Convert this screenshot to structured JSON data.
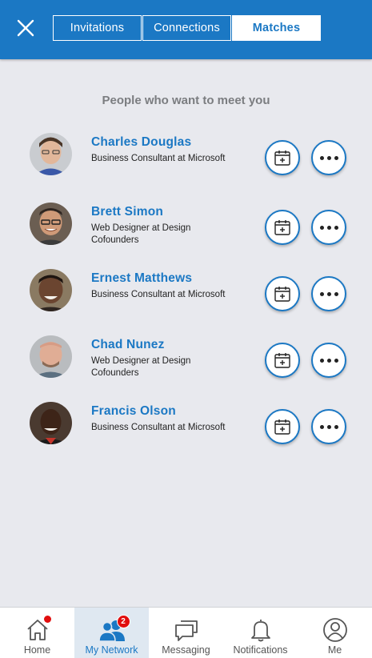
{
  "header": {
    "close_icon": "close-icon",
    "tabs": [
      {
        "label": "Invitations",
        "active": false
      },
      {
        "label": "Connections",
        "active": false
      },
      {
        "label": "Matches",
        "active": true
      }
    ],
    "accent_color": "#1b78c4"
  },
  "section": {
    "title": "People who want to meet you"
  },
  "people": [
    {
      "name": "Charles Douglas",
      "title": "Business Consultant at Microsoft"
    },
    {
      "name": "Brett Simon",
      "title": "Web Designer at Design Cofounders"
    },
    {
      "name": "Ernest Matthews",
      "title": "Business Consultant at Microsoft"
    },
    {
      "name": "Chad Nunez",
      "title": "Web Designer at Design Cofounders"
    },
    {
      "name": "Francis Olson",
      "title": "Business Consultant at Microsoft"
    }
  ],
  "bottom_nav": {
    "items": [
      {
        "label": "Home",
        "icon": "home-icon",
        "badge": "dot"
      },
      {
        "label": "My Network",
        "icon": "people-icon",
        "badge": "2",
        "active": true
      },
      {
        "label": "Messaging",
        "icon": "messaging-icon"
      },
      {
        "label": "Notifications",
        "icon": "bell-icon"
      },
      {
        "label": "Me",
        "icon": "profile-icon"
      }
    ]
  }
}
